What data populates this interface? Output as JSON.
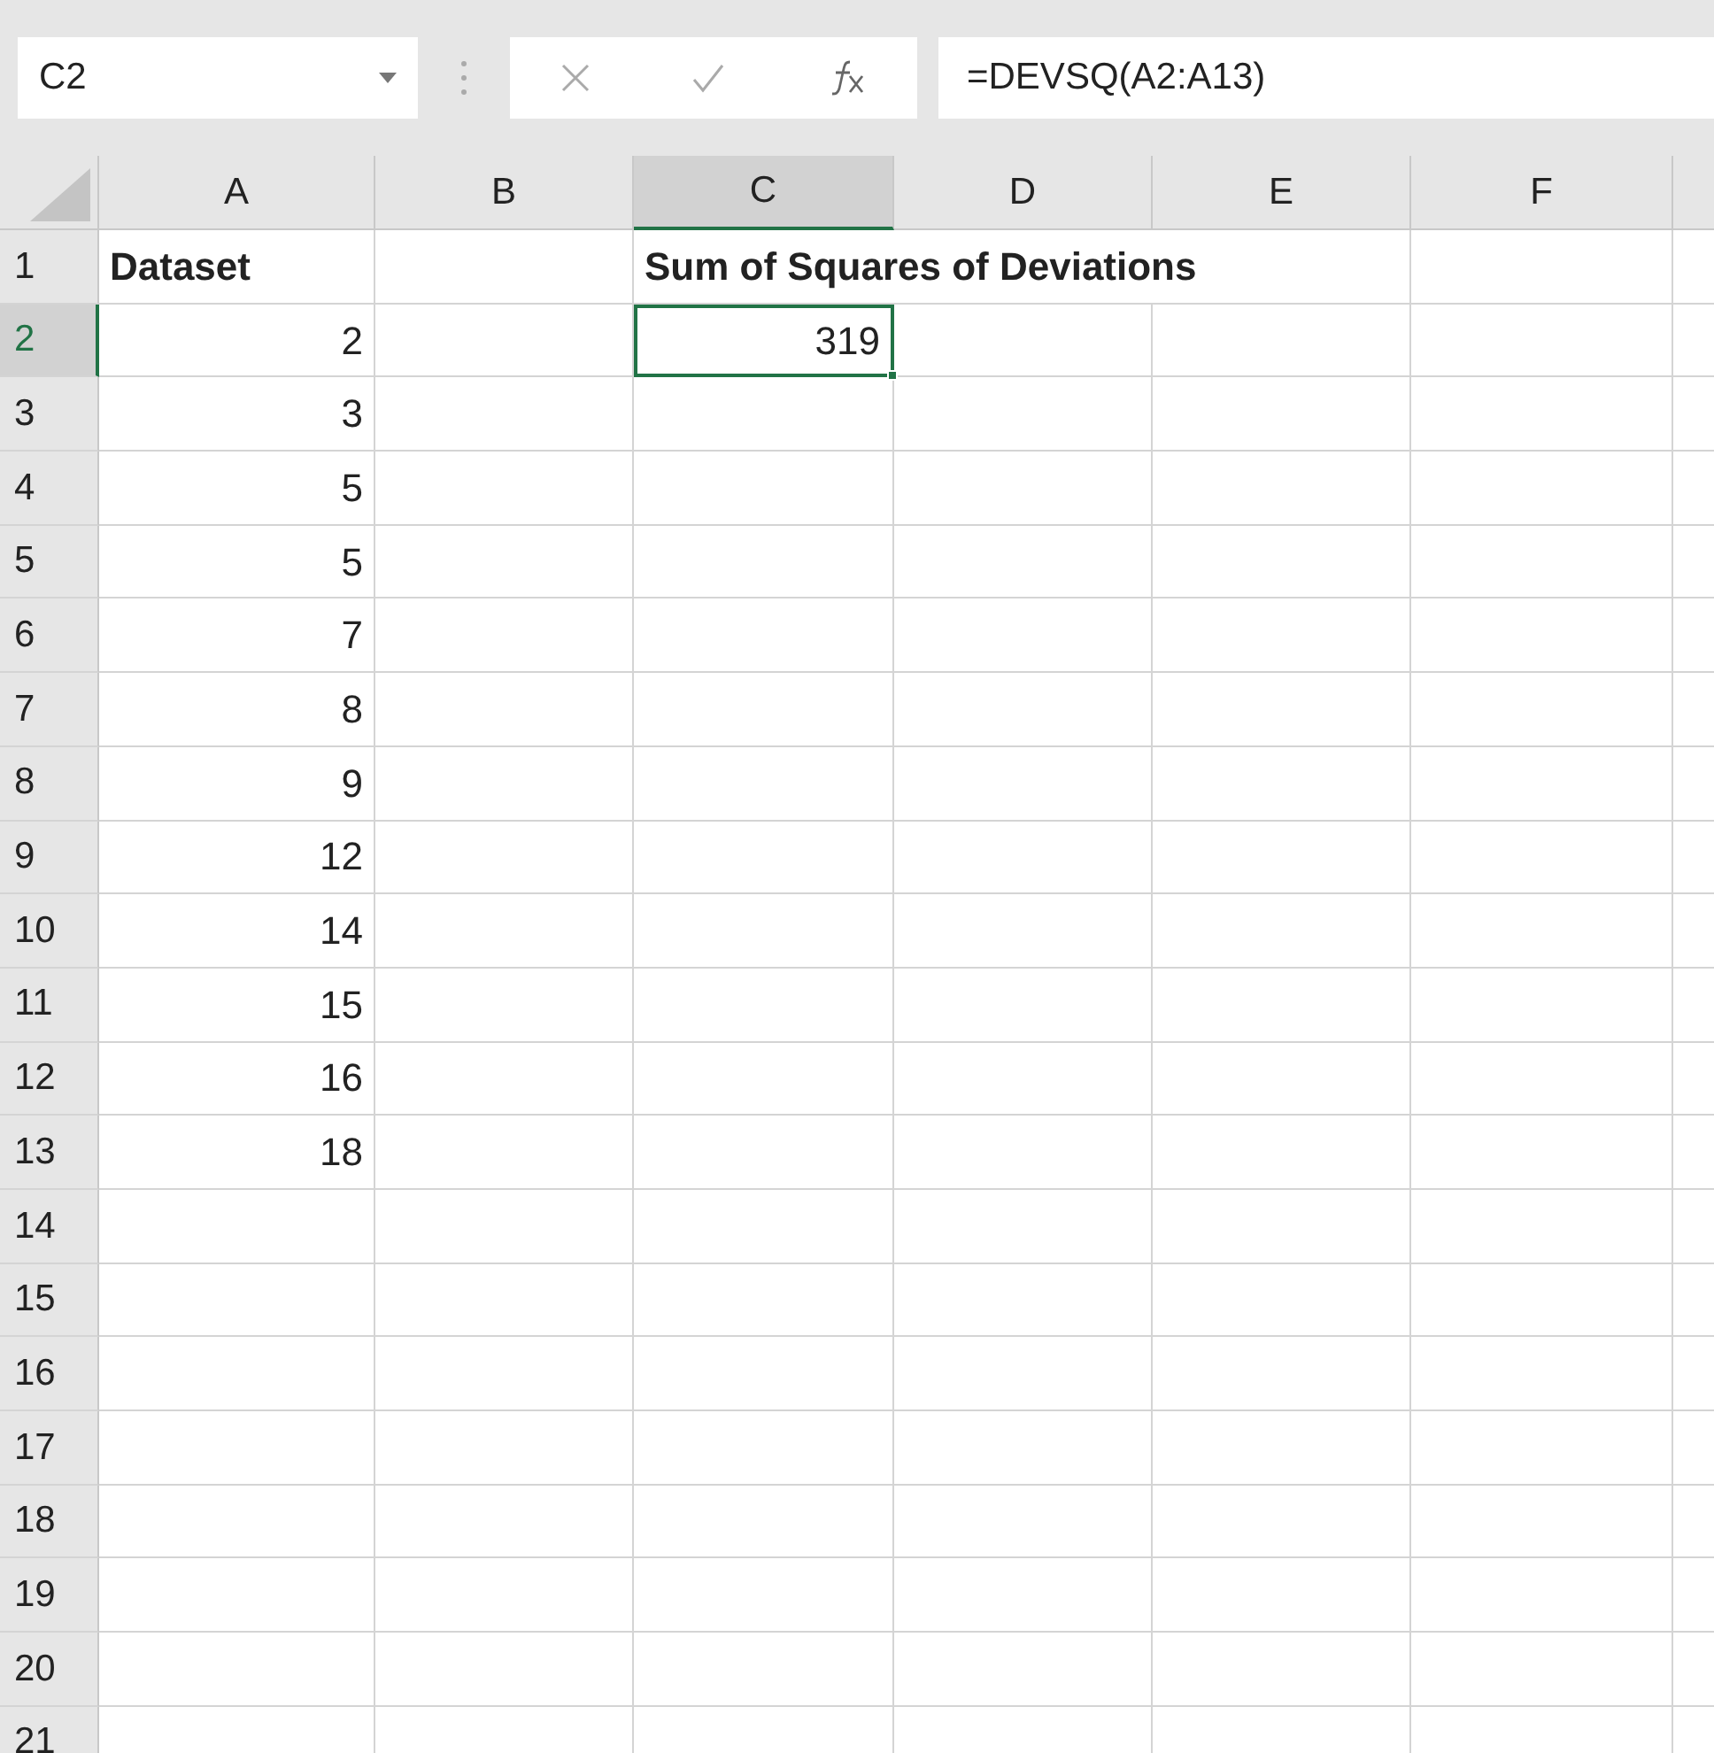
{
  "name_box": "C2",
  "formula": "=DEVSQ(A2:A13)",
  "columns": [
    {
      "label": "A",
      "selected": false
    },
    {
      "label": "B",
      "selected": false
    },
    {
      "label": "C",
      "selected": true
    },
    {
      "label": "D",
      "selected": false
    },
    {
      "label": "E",
      "selected": false
    },
    {
      "label": "F",
      "selected": false
    }
  ],
  "rows": [
    {
      "label": "1",
      "selected": false,
      "kind": "header",
      "cells": [
        "Dataset",
        null,
        "Sum of Squares of Deviations",
        null,
        null,
        null
      ]
    },
    {
      "label": "2",
      "selected": true,
      "kind": "data",
      "cells": [
        "2",
        null,
        "319",
        null,
        null,
        null
      ]
    },
    {
      "label": "3",
      "selected": false,
      "kind": "data",
      "cells": [
        "3",
        null,
        null,
        null,
        null,
        null
      ]
    },
    {
      "label": "4",
      "selected": false,
      "kind": "data",
      "cells": [
        "5",
        null,
        null,
        null,
        null,
        null
      ]
    },
    {
      "label": "5",
      "selected": false,
      "kind": "data",
      "cells": [
        "5",
        null,
        null,
        null,
        null,
        null
      ]
    },
    {
      "label": "6",
      "selected": false,
      "kind": "data",
      "cells": [
        "7",
        null,
        null,
        null,
        null,
        null
      ]
    },
    {
      "label": "7",
      "selected": false,
      "kind": "data",
      "cells": [
        "8",
        null,
        null,
        null,
        null,
        null
      ]
    },
    {
      "label": "8",
      "selected": false,
      "kind": "data",
      "cells": [
        "9",
        null,
        null,
        null,
        null,
        null
      ]
    },
    {
      "label": "9",
      "selected": false,
      "kind": "data",
      "cells": [
        "12",
        null,
        null,
        null,
        null,
        null
      ]
    },
    {
      "label": "10",
      "selected": false,
      "kind": "data",
      "cells": [
        "14",
        null,
        null,
        null,
        null,
        null
      ]
    },
    {
      "label": "11",
      "selected": false,
      "kind": "data",
      "cells": [
        "15",
        null,
        null,
        null,
        null,
        null
      ]
    },
    {
      "label": "12",
      "selected": false,
      "kind": "data",
      "cells": [
        "16",
        null,
        null,
        null,
        null,
        null
      ]
    },
    {
      "label": "13",
      "selected": false,
      "kind": "data",
      "cells": [
        "18",
        null,
        null,
        null,
        null,
        null
      ]
    },
    {
      "label": "14",
      "selected": false,
      "kind": "data",
      "cells": [
        null,
        null,
        null,
        null,
        null,
        null
      ]
    },
    {
      "label": "15",
      "selected": false,
      "kind": "data",
      "cells": [
        null,
        null,
        null,
        null,
        null,
        null
      ]
    },
    {
      "label": "16",
      "selected": false,
      "kind": "data",
      "cells": [
        null,
        null,
        null,
        null,
        null,
        null
      ]
    },
    {
      "label": "17",
      "selected": false,
      "kind": "data",
      "cells": [
        null,
        null,
        null,
        null,
        null,
        null
      ]
    },
    {
      "label": "18",
      "selected": false,
      "kind": "data",
      "cells": [
        null,
        null,
        null,
        null,
        null,
        null
      ]
    },
    {
      "label": "19",
      "selected": false,
      "kind": "data",
      "cells": [
        null,
        null,
        null,
        null,
        null,
        null
      ]
    },
    {
      "label": "20",
      "selected": false,
      "kind": "data",
      "cells": [
        null,
        null,
        null,
        null,
        null,
        null
      ]
    },
    {
      "label": "21",
      "selected": false,
      "kind": "data",
      "cells": [
        null,
        null,
        null,
        null,
        null,
        null
      ]
    }
  ]
}
